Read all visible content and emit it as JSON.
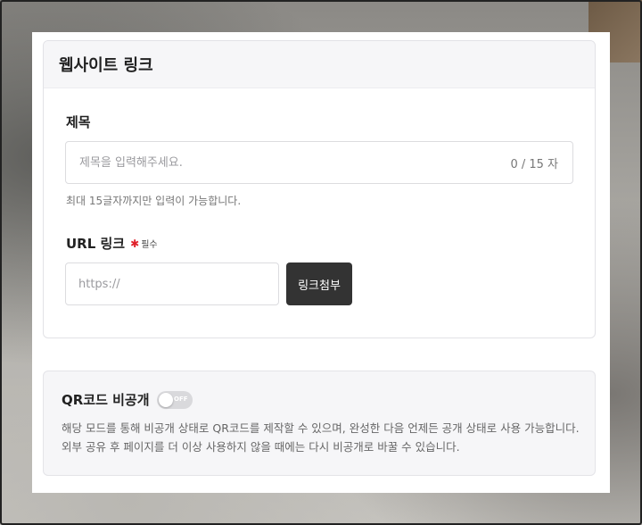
{
  "card": {
    "title": "웹사이트 링크"
  },
  "title_field": {
    "label": "제목",
    "placeholder": "제목을 입력해주세요.",
    "value": "",
    "counter": "0 / 15 자",
    "hint": "최대 15글자까지만 입력이 가능합니다."
  },
  "url_field": {
    "label": "URL 링크",
    "required_mark": "✱",
    "required_text": "필수",
    "placeholder": "https://",
    "value": "",
    "attach_button": "링크첨부"
  },
  "qr": {
    "title": "QR코드 비공개",
    "toggle_state": "OFF",
    "description": "해당 모드를 통해 비공개 상태로 QR코드를 제작할 수 있으며, 완성한 다음 언제든 공개 상태로 사용 가능합니다. 외부 공유 후 페이지를 더 이상 사용하지 않을 때에는 다시 비공개로 바꿀 수 있습니다."
  },
  "colors": {
    "required": "#e0202a",
    "button_bg": "#333333",
    "toggle_off": "#d9d9dc"
  }
}
